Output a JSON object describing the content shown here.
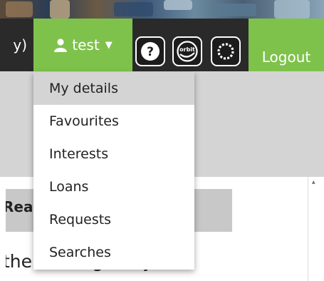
{
  "header": {
    "nav_fragment": "y)",
    "user": {
      "name": "test"
    },
    "tools": [
      {
        "icon": "help-icon",
        "label": "?"
      },
      {
        "icon": "orbit-icon",
        "label": "orbit"
      },
      {
        "icon": "ring-icon",
        "label": ""
      }
    ],
    "logout_label": "Logout",
    "accent_color": "#7ec24b"
  },
  "user_dropdown": {
    "items": [
      {
        "label": "My details",
        "active": true
      },
      {
        "label": "Favourites"
      },
      {
        "label": "Interests"
      },
      {
        "label": "Loans"
      },
      {
        "label": "Requests"
      },
      {
        "label": "Searches"
      }
    ]
  },
  "content": {
    "panel_title": "Rea",
    "panel_text": "the catalogue by"
  }
}
